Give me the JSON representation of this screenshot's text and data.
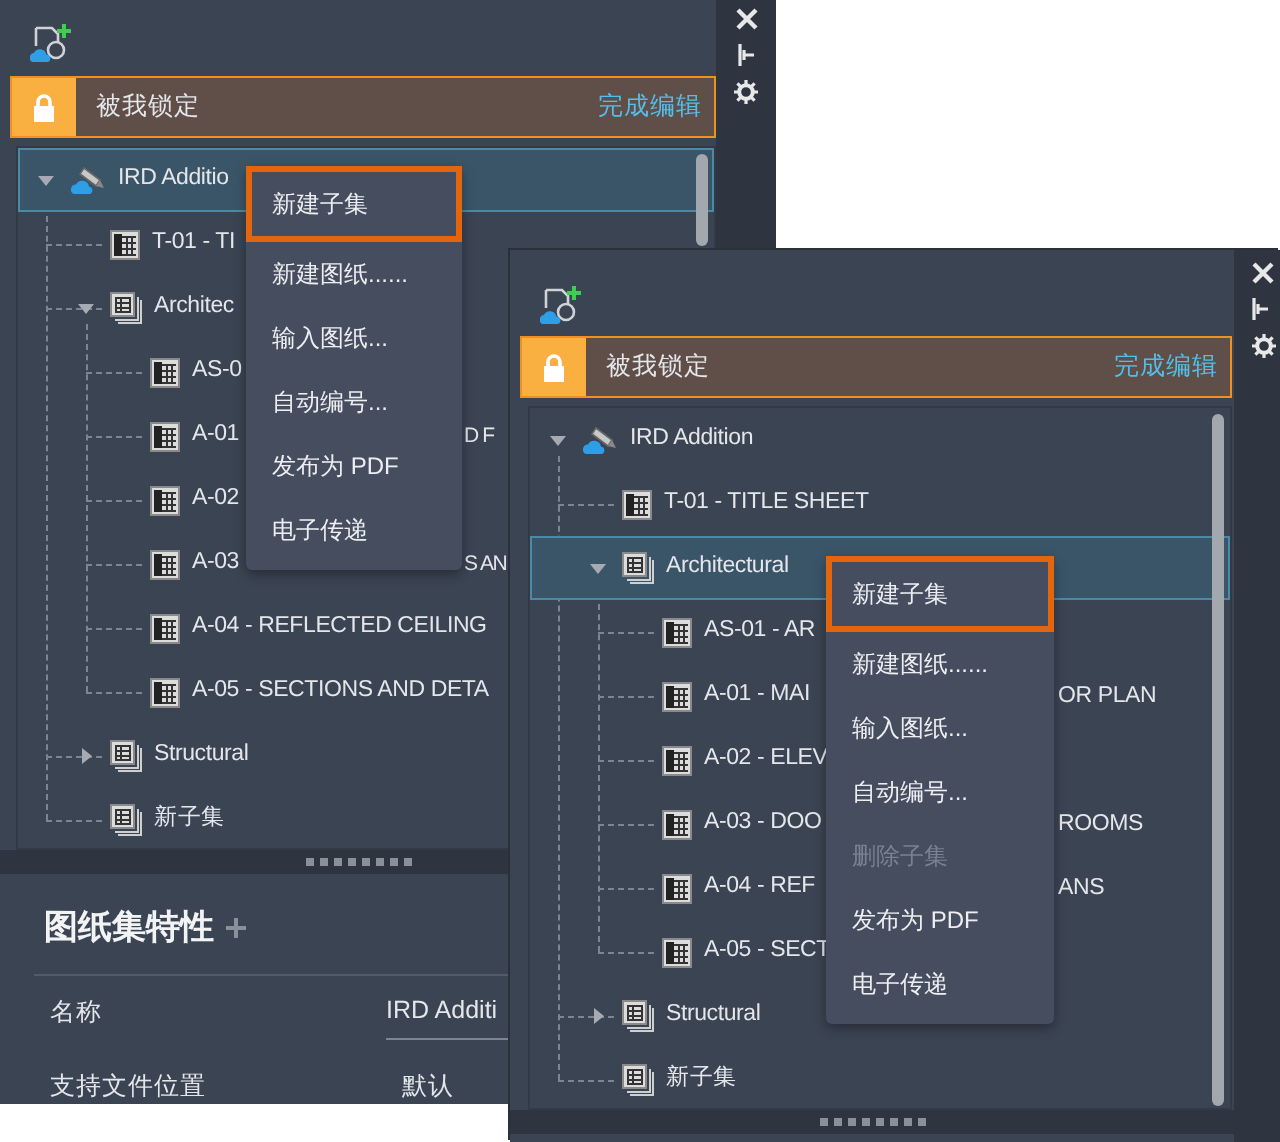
{
  "panels": [
    {
      "lock_bar": {
        "label": "被我锁定",
        "action": "完成编辑"
      },
      "tree": [
        {
          "label": "IRD Additio",
          "kind": "sheet-set",
          "expanded": true,
          "selected": true,
          "children": [
            {
              "label": "T-01 - TI",
              "kind": "sheet",
              "selected": false
            },
            {
              "label": "Architec",
              "kind": "subset",
              "expanded": true,
              "selected": false,
              "children": [
                {
                  "label": "AS-0",
                  "kind": "sheet",
                  "selected": false
                },
                {
                  "label": "A-01",
                  "tail": "D F",
                  "kind": "sheet",
                  "selected": false
                },
                {
                  "label": "A-02",
                  "kind": "sheet",
                  "selected": false
                },
                {
                  "label": "A-03",
                  "tail": "S AN",
                  "kind": "sheet",
                  "selected": false
                },
                {
                  "label": "A-04 - REFLECTED CEILING",
                  "kind": "sheet",
                  "selected": false
                },
                {
                  "label": "A-05 - SECTIONS AND DETA",
                  "kind": "sheet",
                  "selected": false
                }
              ]
            },
            {
              "label": "Structural",
              "kind": "subset",
              "expanded": false,
              "selected": false
            },
            {
              "label": "新子集",
              "kind": "subset",
              "selected": false
            }
          ]
        }
      ],
      "context_menu": [
        {
          "label": "新建子集",
          "highlighted": true,
          "disabled": false
        },
        {
          "label": "新建图纸......",
          "highlighted": false,
          "disabled": false
        },
        {
          "label": "输入图纸...",
          "highlighted": false,
          "disabled": false
        },
        {
          "label": "自动编号...",
          "highlighted": false,
          "disabled": false
        },
        {
          "label": "发布为 PDF",
          "highlighted": false,
          "disabled": false
        },
        {
          "label": "电子传递",
          "highlighted": false,
          "disabled": false
        }
      ],
      "properties": {
        "title": "图纸集特性",
        "rows": [
          {
            "name": "名称",
            "value": "IRD Additi",
            "kind": "field"
          },
          {
            "name": "支持文件位置",
            "value": "默认",
            "kind": "text"
          }
        ]
      }
    },
    {
      "lock_bar": {
        "label": "被我锁定",
        "action": "完成编辑"
      },
      "tree": [
        {
          "label": "IRD Addition",
          "kind": "sheet-set",
          "expanded": true,
          "selected": false,
          "children": [
            {
              "label": "T-01 - TITLE SHEET",
              "kind": "sheet",
              "selected": false
            },
            {
              "label": "Architectural",
              "kind": "subset",
              "expanded": true,
              "selected": true,
              "children": [
                {
                  "label": "AS-01 - AR",
                  "kind": "sheet",
                  "selected": false
                },
                {
                  "label": "A-01 - MAI",
                  "tail": "OR PLAN",
                  "kind": "sheet",
                  "selected": false
                },
                {
                  "label": "A-02 - ELEV",
                  "kind": "sheet",
                  "selected": false
                },
                {
                  "label": "A-03 - DOO",
                  "tail": "ROOMS",
                  "kind": "sheet",
                  "selected": false
                },
                {
                  "label": "A-04 - REF",
                  "tail": "ANS",
                  "kind": "sheet",
                  "selected": false
                },
                {
                  "label": "A-05 - SECT",
                  "kind": "sheet",
                  "selected": false
                }
              ]
            },
            {
              "label": "Structural",
              "kind": "subset",
              "expanded": false,
              "selected": false
            },
            {
              "label": "新子集",
              "kind": "subset",
              "selected": false
            }
          ]
        }
      ],
      "context_menu": [
        {
          "label": "新建子集",
          "highlighted": true,
          "disabled": false
        },
        {
          "label": "新建图纸......",
          "highlighted": false,
          "disabled": false
        },
        {
          "label": "输入图纸...",
          "highlighted": false,
          "disabled": false
        },
        {
          "label": "自动编号...",
          "highlighted": false,
          "disabled": false
        },
        {
          "label": "删除子集",
          "highlighted": false,
          "disabled": true
        },
        {
          "label": "发布为 PDF",
          "highlighted": false,
          "disabled": false
        },
        {
          "label": "电子传递",
          "highlighted": false,
          "disabled": false
        }
      ]
    }
  ]
}
